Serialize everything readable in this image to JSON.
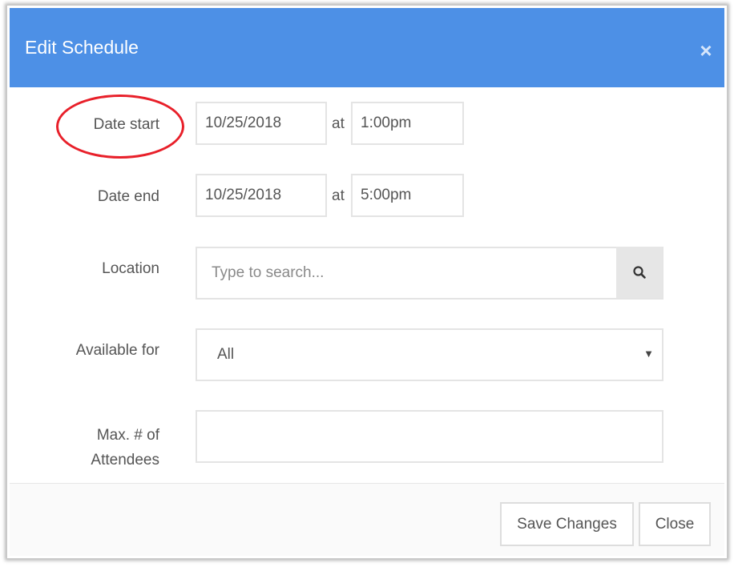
{
  "modal": {
    "title": "Edit Schedule",
    "close_glyph": "×"
  },
  "form": {
    "date_start": {
      "label": "Date start",
      "date": "10/25/2018",
      "at": "at",
      "time": "1:00pm"
    },
    "date_end": {
      "label": "Date end",
      "date": "10/25/2018",
      "at": "at",
      "time": "5:00pm"
    },
    "location": {
      "label": "Location",
      "placeholder": "Type to search..."
    },
    "available_for": {
      "label": "Available for",
      "selected": "All"
    },
    "max_attendees": {
      "label_line1": "Max. # of",
      "label_line2": "Attendees",
      "value": ""
    }
  },
  "footer": {
    "save_label": "Save Changes",
    "close_label": "Close"
  },
  "annotation": {
    "highlight_color": "#e8202a"
  },
  "colors": {
    "header": "#4d90e6",
    "title_text": "#ffffff"
  },
  "icons": {
    "search": "search-icon",
    "dropdown": "caret-down-icon",
    "close": "close-icon"
  }
}
